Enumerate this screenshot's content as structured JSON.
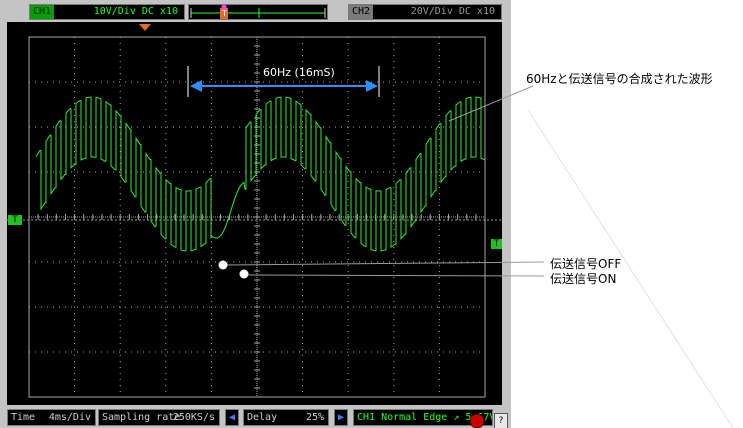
{
  "toolbar": {
    "ch1": {
      "tag": "CH1",
      "info": "10V/Div DC x10"
    },
    "ch2": {
      "tag": "CH2",
      "info": "20V/Div DC x10"
    },
    "trigger_marker": "T"
  },
  "screen": {
    "ch1_marker": "T",
    "trigger_level_marker": "T",
    "period_label": "60Hz (16mS)"
  },
  "statusbar": {
    "time": {
      "label": "Time",
      "value": "4ms/Div"
    },
    "sampling": {
      "label": "Sampling rate",
      "value": "250KS/s"
    },
    "delay": {
      "label": "Delay",
      "value": "25%"
    },
    "trigger": "CH1 Normal Edge ↗ 5.67V"
  },
  "annotations": {
    "composite": "60Hzと伝送信号の合成された波形",
    "signal_off": "伝送信号OFF",
    "signal_on": "伝送信号ON"
  },
  "colors": {
    "trace": "#33e833",
    "grid": "#a8a8a8",
    "measure": "#2b8fff",
    "ch1": "#22ff22"
  }
}
